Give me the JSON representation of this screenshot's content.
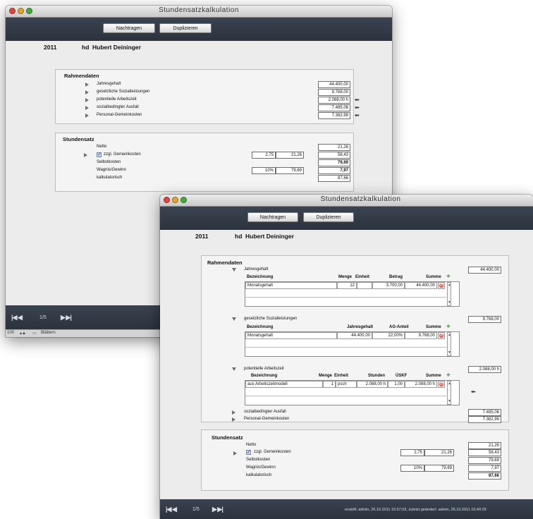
{
  "window": {
    "title": "Stundensatzkalkulation",
    "toolbar": {
      "nachtragen": "Nachtragen",
      "duplizieren": "Duplizieren"
    }
  },
  "header": {
    "year": "2011",
    "initials": "hd",
    "name": "Hubert Deininger"
  },
  "rahmendaten": {
    "title": "Rahmendaten",
    "jahresgehalt": {
      "label": "Jahresgehalt",
      "value": "44.400,00"
    },
    "sozial": {
      "label": "gesetzliche Sozialleistungen",
      "value": "9.768,00"
    },
    "arbeitszeit": {
      "label": "potentielle Arbeitszeit",
      "value": "2.088,00 h"
    },
    "ausfall": {
      "label": "sozialbedingter Ausfall",
      "value": "7.485,06"
    },
    "gemeinkosten": {
      "label": "Personal-Gemeinkosten",
      "value": "7.382,99"
    }
  },
  "table1": {
    "h_bez": "Bezeichnung",
    "h_menge": "Menge",
    "h_einheit": "Einheit",
    "h_betrag": "Betrag",
    "h_summe": "Summe",
    "row": {
      "bez": "Monatsgehalt",
      "menge": "12",
      "einheit": "",
      "betrag": "3.700,00",
      "summe": "44.400,00"
    }
  },
  "table2": {
    "h_bez": "Bezeichnung",
    "h_jahresgehalt": "Jahresgehalt",
    "h_ag": "AG-Anteil",
    "h_summe": "Summe",
    "row": {
      "bez": "Monatsgehalt",
      "jahresgehalt": "44.400,00",
      "ag": "22,00%",
      "summe": "9.768,00"
    }
  },
  "table3": {
    "h_bez": "Bezeichnung",
    "h_menge": "Menge",
    "h_einheit": "Einheit",
    "h_stunden": "Stunden",
    "h_uskf": "ÜSKF",
    "h_summe": "Summe",
    "row": {
      "bez": "aus Arbeitszeitmodell",
      "menge": "1",
      "einheit": "psch",
      "stunden": "2.088,00 h",
      "uskf": "1,00",
      "summe": "2.088,00 h"
    }
  },
  "stundensatz": {
    "title": "Stundensatz",
    "netto": {
      "label": "Netto",
      "value": "21,26"
    },
    "gemeinkosten": {
      "label": "zzgl. Gemeinkosten",
      "factor": "2,75",
      "base": "21,26",
      "value": "58,43",
      "checked": true
    },
    "selbstkosten": {
      "label": "Selbstkosten",
      "value": "79,69"
    },
    "wagnis": {
      "label": "Wagnis/Gewinn",
      "pct": "10%",
      "base": "79,69",
      "value": "7,97"
    },
    "kalkulatorisch": {
      "label": "kalkulatorisch",
      "value": "87,66"
    }
  },
  "footer": {
    "record": "1/5",
    "meta": "erstellt: admin, 26.10.2011 15:57:03, zuletzt geändert: admin, 26.10.2011 15:40:29",
    "zoom": "100",
    "mode": "Blättern"
  },
  "colors": {
    "toolbar": "#2f3843",
    "plus": "#3d9e2e",
    "delete": "#e34a3b"
  },
  "icons": {
    "expand_collapsed": "triangle-right-icon",
    "expand_open": "triangle-down-icon",
    "arrow": "left-arrow-icon",
    "add": "plus-icon",
    "delete": "delete-icon"
  }
}
